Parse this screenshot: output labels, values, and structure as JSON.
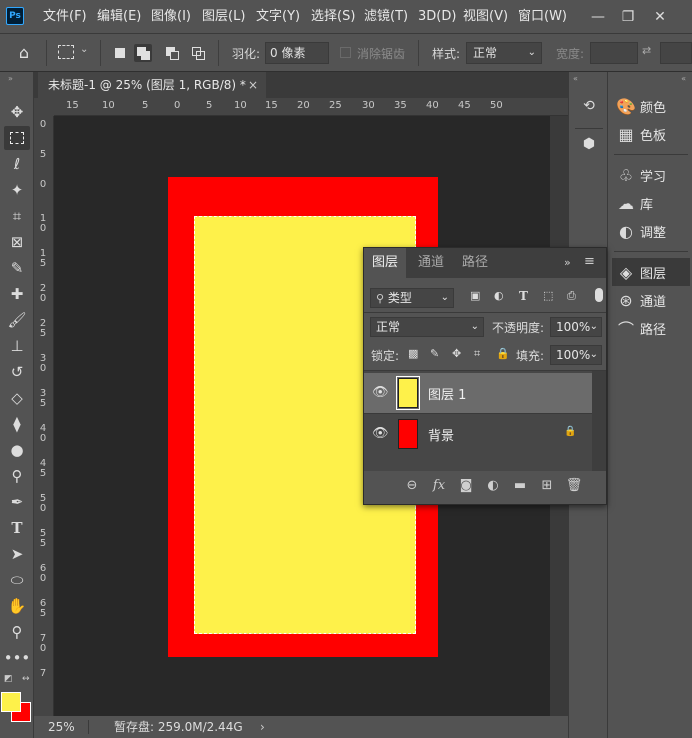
{
  "app": {
    "logo": "Ps"
  },
  "menu": [
    "文件(F)",
    "编辑(E)",
    "图像(I)",
    "图层(L)",
    "文字(Y)",
    "选择(S)",
    "滤镜(T)",
    "3D(D)",
    "视图(V)",
    "窗口(W)"
  ],
  "options": {
    "feather_label": "羽化:",
    "feather_value": "0 像素",
    "antialias_label": "消除锯齿",
    "style_label": "样式:",
    "style_value": "正常",
    "width_label": "宽度:"
  },
  "document": {
    "tab_title": "未标题-1 @ 25% (图层 1, RGB/8) *",
    "close_glyph": "×",
    "ruler_top": [
      "15",
      "10",
      "5",
      "0",
      "5",
      "10",
      "15",
      "20",
      "25",
      "30",
      "35",
      "40",
      "45",
      "50"
    ],
    "ruler_left": [
      "0",
      "5",
      "0",
      "1\n0",
      "1\n5",
      "2\n0",
      "2\n5",
      "3\n0",
      "3\n5",
      "4\n0",
      "4\n5",
      "5\n0",
      "5\n5",
      "6\n0",
      "6\n5",
      "7\n0",
      "7"
    ],
    "zoom": "25%",
    "scratch": "暂存盘: 259.0M/2.44G",
    "colors": {
      "background_layer": "#ff0000",
      "layer1": "#fef14a",
      "foreground": "#fef14a",
      "background": "#ff0000"
    }
  },
  "right_panels": {
    "items": [
      {
        "icon": "palette-icon",
        "label": "颜色"
      },
      {
        "icon": "swatches-icon",
        "label": "色板"
      },
      {
        "icon": "lightbulb-icon",
        "label": "学习"
      },
      {
        "icon": "libraries-icon",
        "label": "库"
      },
      {
        "icon": "adjustments-icon",
        "label": "调整"
      },
      {
        "icon": "layers-icon",
        "label": "图层"
      },
      {
        "icon": "channels-icon",
        "label": "通道"
      },
      {
        "icon": "paths-icon",
        "label": "路径"
      }
    ]
  },
  "layers_panel": {
    "tabs": [
      "图层",
      "通道",
      "路径"
    ],
    "kind_filter": "类型",
    "blend_mode": "正常",
    "opacity_label": "不透明度:",
    "opacity_value": "100%",
    "lock_label": "锁定:",
    "fill_label": "填充:",
    "fill_value": "100%",
    "layers": [
      {
        "name": "图层 1",
        "color": "#fef14a",
        "selected": true,
        "locked": false
      },
      {
        "name": "背景",
        "color": "#ff0000",
        "selected": false,
        "locked": true
      }
    ]
  }
}
